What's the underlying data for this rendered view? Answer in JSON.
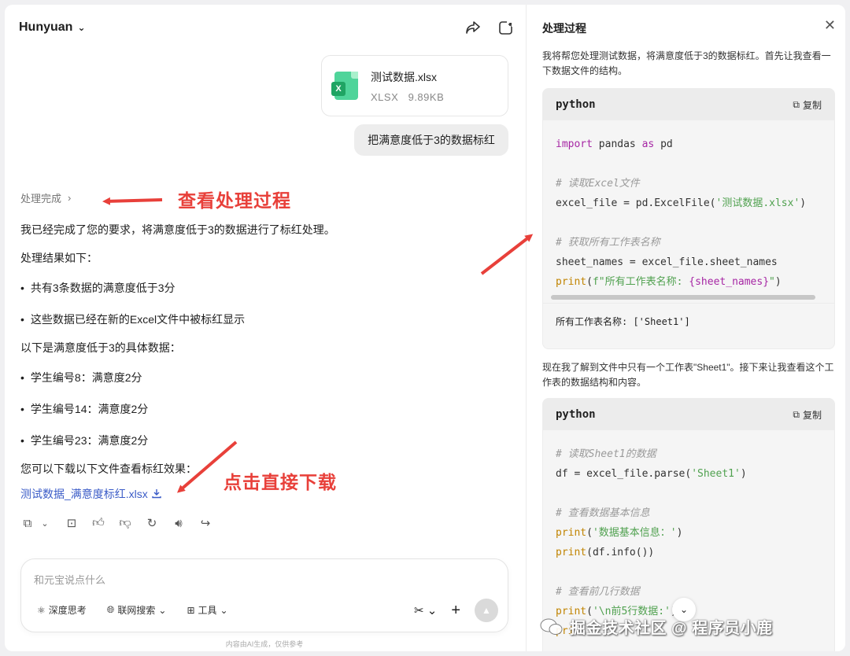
{
  "header": {
    "brand": "Hunyuan"
  },
  "file": {
    "name": "测试数据.xlsx",
    "type": "XLSX",
    "size": "9.89KB",
    "icon_letter": "X"
  },
  "user_message": "把满意度低于3的数据标红",
  "status": "处理完成",
  "reply": {
    "intro": "我已经完成了您的要求，将满意度低于3的数据进行了标红处理。",
    "result_label": "处理结果如下：",
    "bullet1": "共有3条数据的满意度低于3分",
    "bullet2": "这些数据已经在新的Excel文件中被标红显示",
    "detail_label": "以下是满意度低于3的具体数据：",
    "bullet3": "学生编号8：满意度2分",
    "bullet4": "学生编号14：满意度2分",
    "bullet5": "学生编号23：满意度2分",
    "download_label": "您可以下载以下文件查看标红效果：",
    "download_file": "测试数据_满意度标红.xlsx"
  },
  "annotations": {
    "view_process": "查看处理过程",
    "click_download": "点击直接下载"
  },
  "composer": {
    "placeholder": "和元宝说点什么",
    "deep_think": "深度思考",
    "web_search": "联网搜索",
    "tools": "工具"
  },
  "disclaimer": "内容由AI生成，仅供参考",
  "panel": {
    "title": "处理过程",
    "text1": "我将帮您处理测试数据，将满意度低于3的数据标红。首先让我查看一下数据文件的结构。",
    "code1": {
      "lang": "python",
      "copy": "复制",
      "l1_kw1": "import",
      "l1_mid": " pandas ",
      "l1_kw2": "as",
      "l1_end": " pd",
      "l2_cm": "# 读取Excel文件",
      "l3_a": "excel_file = pd.ExcelFile(",
      "l3_str": "'测试数据.xlsx'",
      "l3_b": ")",
      "l4_cm": "# 获取所有工作表名称",
      "l5": "sheet_names = excel_file.sheet_names",
      "l6_fn": "print",
      "l6_a": "(",
      "l6_str": "f\"所有工作表名称: ",
      "l6_var": "{sheet_names}",
      "l6_str2": "\"",
      "l6_b": ")",
      "output": "所有工作表名称: ['Sheet1']"
    },
    "text2": "现在我了解到文件中只有一个工作表\"Sheet1\"。接下来让我查看这个工作表的数据结构和内容。",
    "code2": {
      "lang": "python",
      "copy": "复制",
      "l1_cm": "# 读取Sheet1的数据",
      "l2_a": "df = excel_file.parse(",
      "l2_str": "'Sheet1'",
      "l2_b": ")",
      "l3_cm": "# 查看数据基本信息",
      "l4_fn": "print",
      "l4_a": "(",
      "l4_str": "'数据基本信息：'",
      "l4_b": ")",
      "l5_fn": "print",
      "l5_a": "(df.info())",
      "l6_cm": "# 查看前几行数据",
      "l7_fn": "print",
      "l7_a": "(",
      "l7_str": "'\\n前5行数据:'",
      "l7_b": ")",
      "l8_fn": "pri"
    }
  },
  "watermark": "掘金技术社区 @ 程序员小鹿"
}
